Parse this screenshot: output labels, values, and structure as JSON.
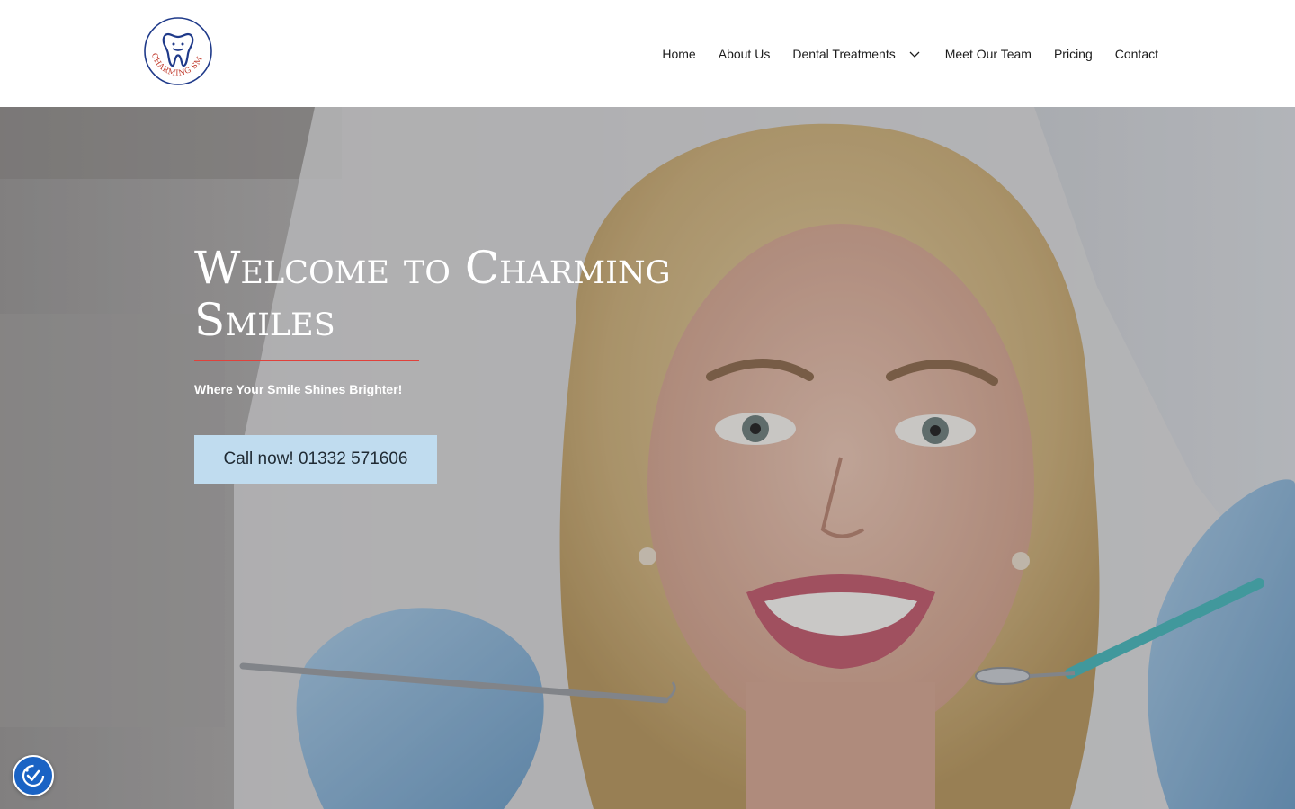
{
  "brand": {
    "logo_text": "CHARMING SMILES",
    "colors": {
      "accent_red": "#e0413b",
      "cta_bg": "#c0dcef",
      "logo_navy": "#1f3a8a",
      "accessibility_blue": "#1a63c4"
    }
  },
  "nav": {
    "items": [
      {
        "label": "Home"
      },
      {
        "label": "About Us"
      },
      {
        "label": "Dental Treatments",
        "has_dropdown": true
      },
      {
        "label": "Meet Our Team"
      },
      {
        "label": "Pricing"
      },
      {
        "label": "Contact"
      }
    ]
  },
  "hero": {
    "title": "Welcome to Charming Smiles",
    "subtitle": "Where Your Smile Shines Brighter!",
    "cta_label": "Call now! 01332 571606"
  },
  "widgets": {
    "accessibility_icon": "accessibility-check-icon"
  }
}
